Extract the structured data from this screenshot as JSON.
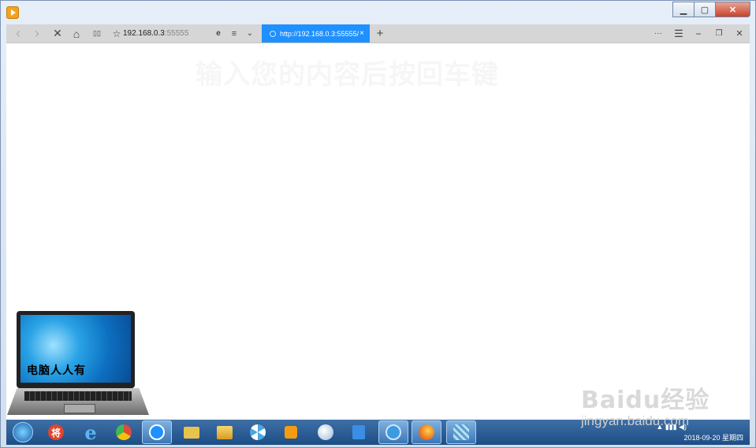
{
  "window": {
    "controls": {
      "minimize": "▁",
      "maximize": "▢",
      "close": "✕"
    }
  },
  "toolbar": {
    "back_icon": "‹",
    "forward_icon": "›",
    "stop_icon": "✕",
    "home_icon": "⌂",
    "reader_icon": "▯▯",
    "favorite_icon": "☆",
    "address_host": "192.168.0.3",
    "address_port": ":55555",
    "ie_icon": "e",
    "list_icon": "≡",
    "chevron_icon": "⌄",
    "active_tab": {
      "title": "http://192.168.0.3:55555/",
      "close": "×"
    },
    "new_tab": "+",
    "more": "···",
    "menu": "☰",
    "min": "−",
    "restore": "❐",
    "close": "✕"
  },
  "content": {
    "ghost_heading": "输入您的内容后按回车键"
  },
  "logo": {
    "laptop_caption": "电脑人人有"
  },
  "taskbar": {
    "items": [
      {
        "name": "start",
        "icon": "windows-orb"
      },
      {
        "name": "app-jiang",
        "label": "将",
        "color": "#e0452c"
      },
      {
        "name": "ie",
        "label": "e",
        "color": "#2b7fd1"
      },
      {
        "name": "chrome",
        "color": "#dd4b39"
      },
      {
        "name": "browser-active",
        "color": "#1e90ff"
      },
      {
        "name": "folder",
        "color": "#e8c34a"
      },
      {
        "name": "explorer",
        "color": "#f0c24a"
      },
      {
        "name": "fan-app",
        "color": "#4aa8e0"
      },
      {
        "name": "player",
        "color": "#f39c12"
      },
      {
        "name": "paint",
        "color": "#9bbbd6"
      },
      {
        "name": "store",
        "color": "#3a8ee6"
      },
      {
        "name": "qq-app",
        "color": "#3b9ae1"
      },
      {
        "name": "firefox",
        "color": "#e5691d"
      },
      {
        "name": "network-app",
        "color": "#5aa0d0"
      }
    ],
    "tray": {
      "icons": "▲  ▮▮▮  ◀)",
      "time": "",
      "date": "2018-09-20 星期四"
    }
  },
  "watermark": {
    "logo": "Baidu经验",
    "url": "jingyan.baidu.com"
  }
}
